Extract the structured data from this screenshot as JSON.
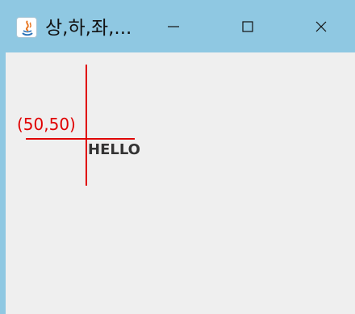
{
  "window": {
    "title": "상,하,좌,...",
    "icons": {
      "app": "java-icon",
      "minimize": "minimize-icon",
      "maximize": "maximize-icon",
      "close": "close-icon"
    },
    "colors": {
      "titlebar": "#8fc8e2",
      "client": "#efefef",
      "accent": "#e00000",
      "text": "#333333"
    }
  },
  "canvas": {
    "coordinate_label": "(50,50)",
    "text": "HELLO"
  }
}
